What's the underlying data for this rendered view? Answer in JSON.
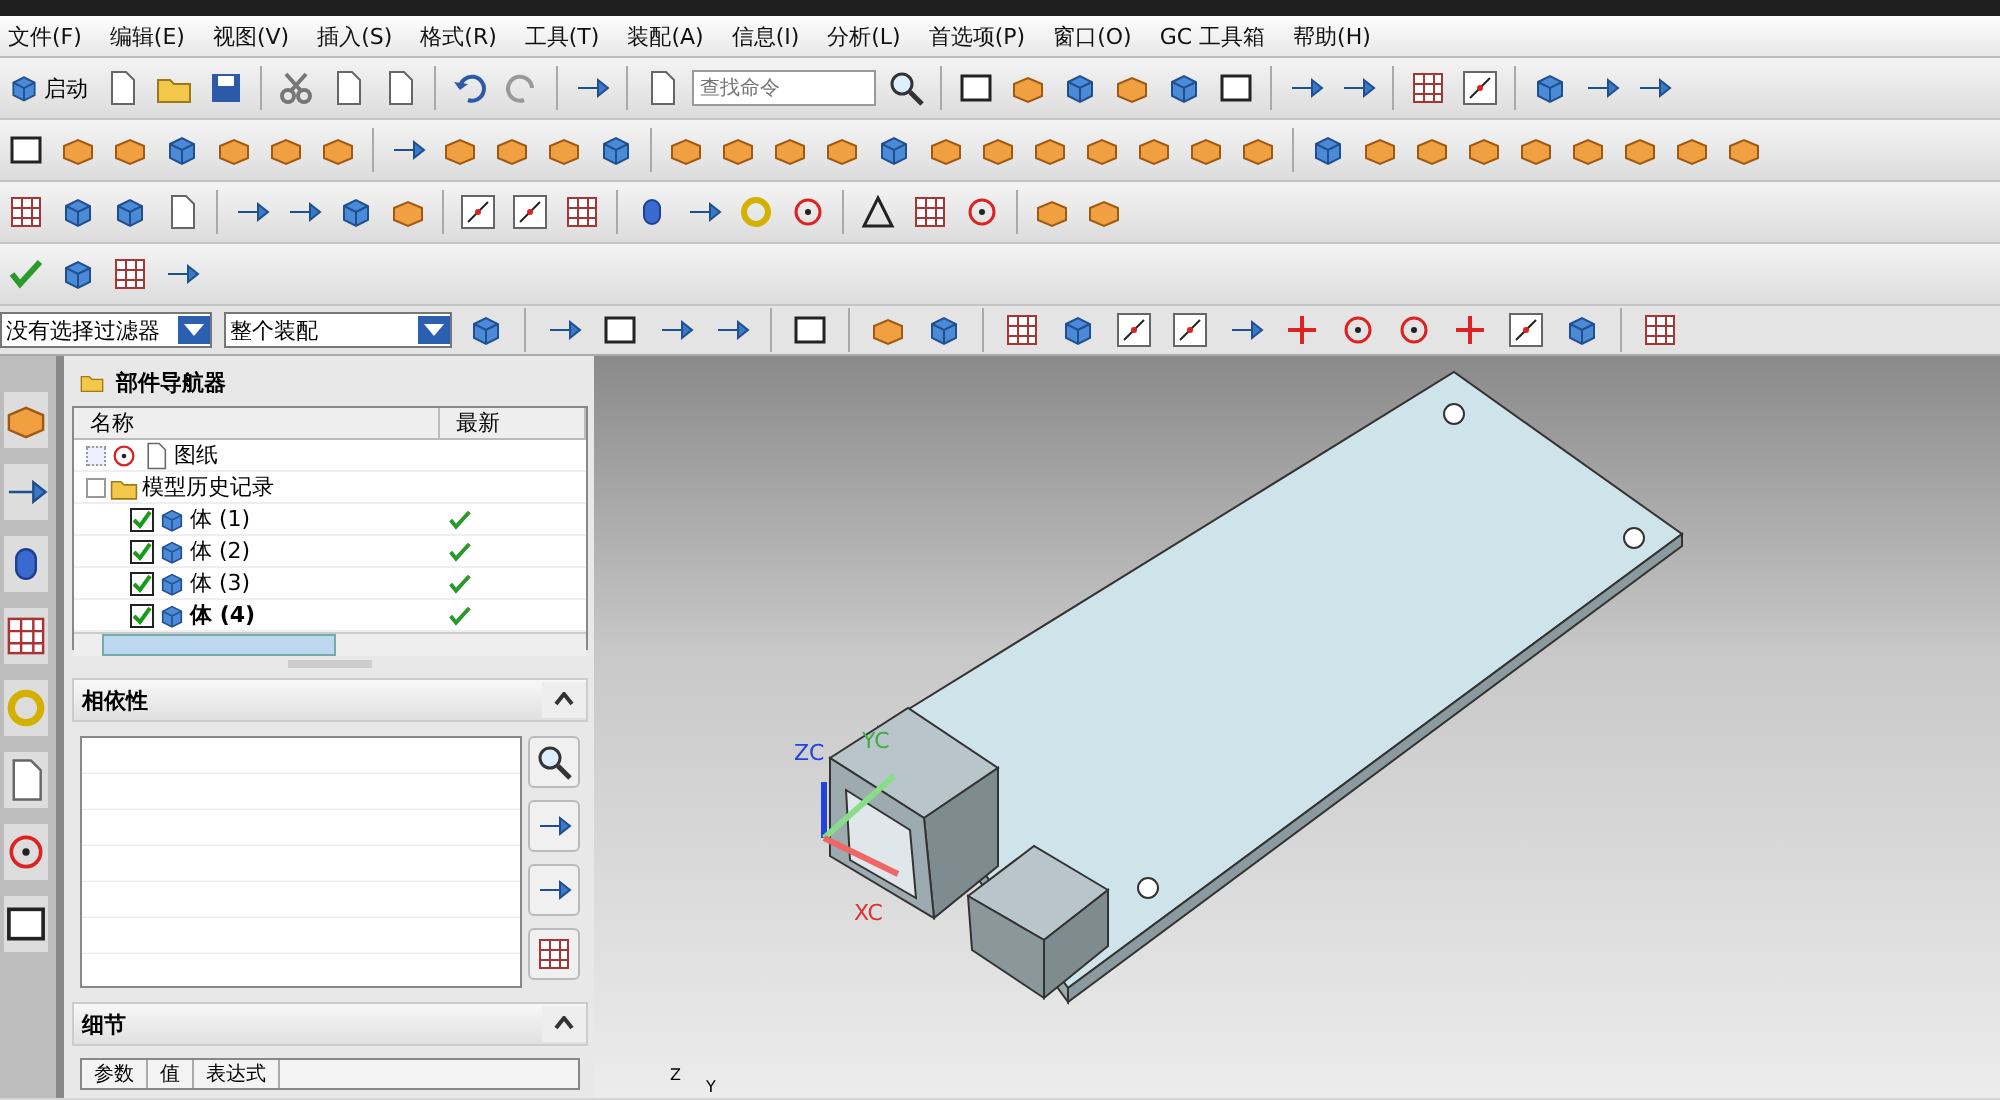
{
  "menu_bar": {
    "items": [
      "文件(F)",
      "编辑(E)",
      "视图(V)",
      "插入(S)",
      "格式(R)",
      "工具(T)",
      "装配(A)",
      "信息(I)",
      "分析(L)",
      "首选项(P)",
      "窗口(O)",
      "GC 工具箱",
      "帮助(H)"
    ]
  },
  "toolbar": {
    "start_label": "启动",
    "search": {
      "placeholder": "查找命令"
    }
  },
  "filter_bar": {
    "type_filter": "没有选择过滤器",
    "scope": "整个装配"
  },
  "part_navigator": {
    "title": "部件导航器",
    "columns": [
      "名称",
      "最新"
    ],
    "nodes": [
      {
        "label": "图纸",
        "kind": "drawing",
        "expanded": false
      },
      {
        "label": "模型历史记录",
        "kind": "folder",
        "expanded": true,
        "children": [
          {
            "label": "体 (1)",
            "kind": "body",
            "checked": true,
            "latest": true,
            "current": false
          },
          {
            "label": "体 (2)",
            "kind": "body",
            "checked": true,
            "latest": true,
            "current": false
          },
          {
            "label": "体 (3)",
            "kind": "body",
            "checked": true,
            "latest": true,
            "current": false
          },
          {
            "label": "体 (4)",
            "kind": "body",
            "checked": true,
            "latest": true,
            "current": true
          }
        ]
      }
    ]
  },
  "dependencies": {
    "title": "相依性"
  },
  "details": {
    "title": "细节",
    "columns": [
      "参数",
      "值",
      "表达式"
    ]
  },
  "viewport": {
    "axis_labels": [
      "ZC",
      "YC",
      "XC"
    ],
    "view_triad": [
      "Z",
      "Y"
    ]
  }
}
